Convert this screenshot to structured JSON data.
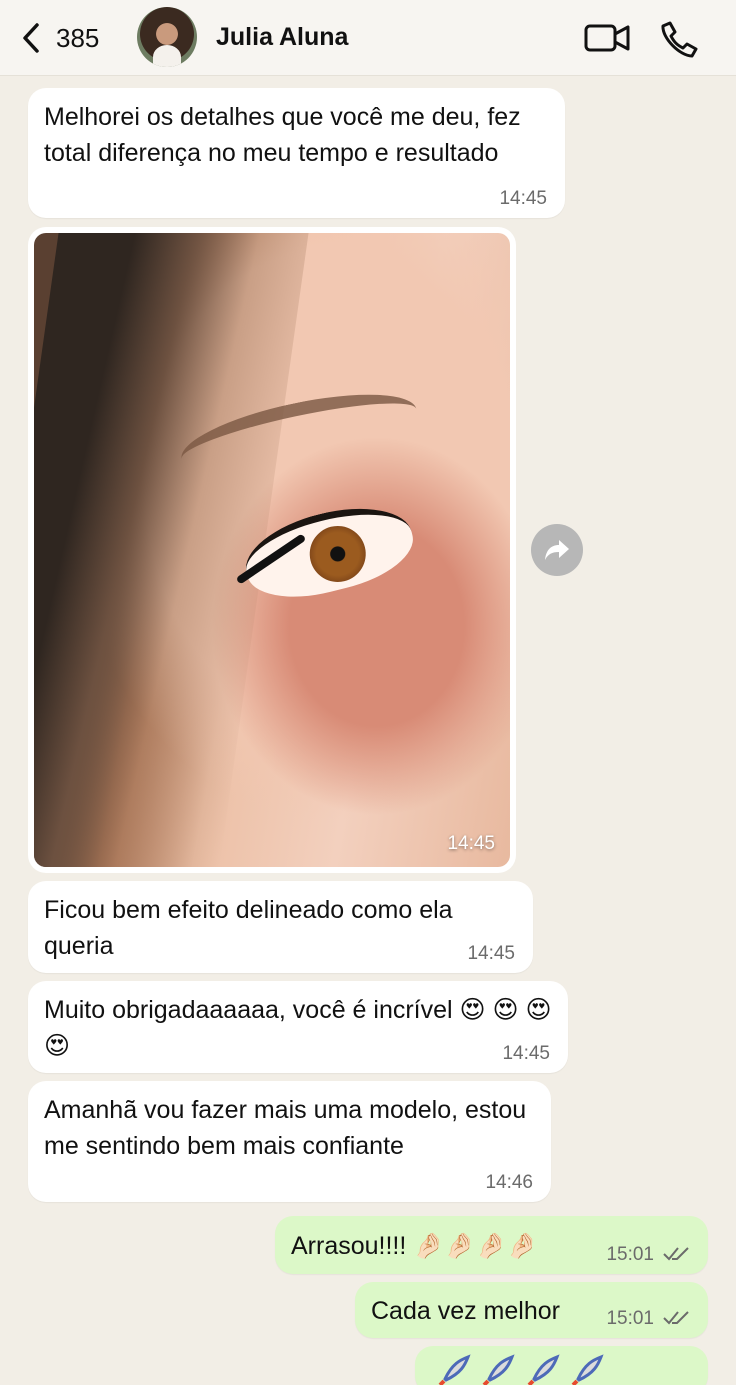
{
  "header": {
    "back_count": "385",
    "contact_name": "Julia Aluna"
  },
  "messages": [
    {
      "text": "Melhorei os detalhes que você me deu, fez total diferença no meu tempo e resultado",
      "time": "14:45"
    },
    {
      "time": "14:45"
    },
    {
      "text": "Ficou bem efeito delineado como ela queria",
      "time": "14:45"
    },
    {
      "text": "Muito obrigadaaaaaa, você é incrível 😍 😍 😍 😍",
      "time": "14:45"
    },
    {
      "text": "Amanhã vou fazer mais uma modelo, estou me sentindo bem mais confiante",
      "time": "14:46"
    },
    {
      "text": "Arrasou!!!! 🤌🏻🤌🏻🤌🏻🤌🏻",
      "time": "15:01"
    },
    {
      "text": "Cada vez melhor",
      "time": "15:01"
    }
  ],
  "icons": {
    "back": "chevron-left-icon",
    "video": "video-call-icon",
    "phone": "phone-icon",
    "forward": "forward-icon",
    "read_status": "double-check-icon"
  },
  "colors": {
    "background": "#f2eee6",
    "incoming_bubble": "#ffffff",
    "outgoing_bubble": "#dcf8c8",
    "time_text": "#6b6b6b"
  }
}
